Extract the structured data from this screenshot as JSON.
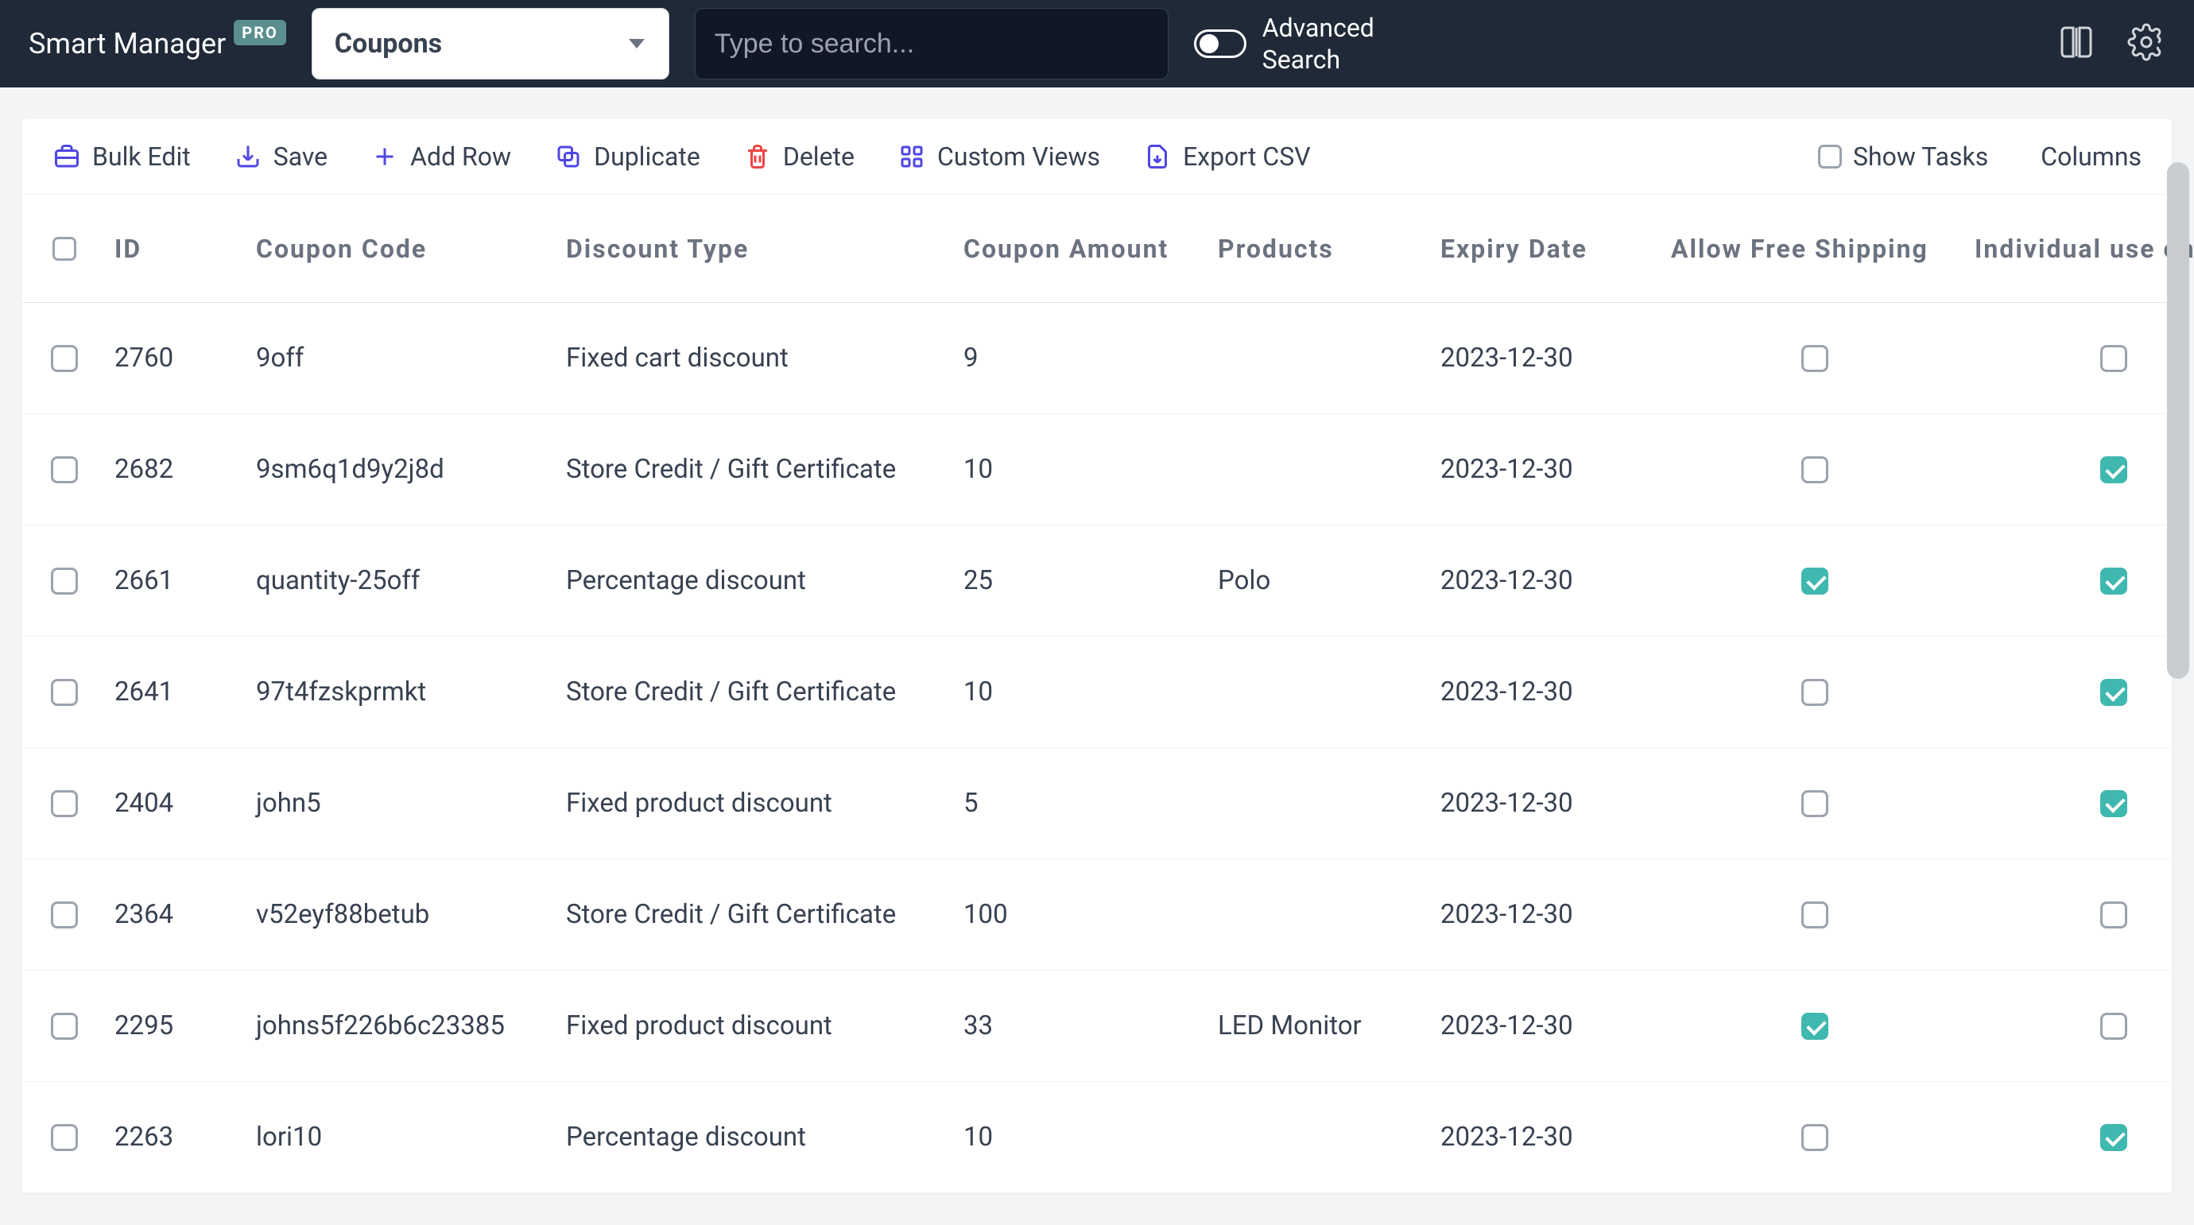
{
  "brand": {
    "title": "Smart Manager",
    "badge": "PRO"
  },
  "selector": {
    "value": "Coupons"
  },
  "search": {
    "placeholder": "Type to search..."
  },
  "advanced": {
    "line1": "Advanced",
    "line2": "Search"
  },
  "toolbar": {
    "bulk_edit": "Bulk Edit",
    "save": "Save",
    "add_row": "Add Row",
    "duplicate": "Duplicate",
    "delete": "Delete",
    "custom_views": "Custom Views",
    "export_csv": "Export CSV",
    "show_tasks": "Show Tasks",
    "columns": "Columns"
  },
  "columns": [
    "ID",
    "Coupon Code",
    "Discount Type",
    "Coupon Amount",
    "Products",
    "Expiry Date",
    "Allow Free Shipping",
    "Individual use only"
  ],
  "rows": [
    {
      "id": "2760",
      "code": "9off",
      "type": "Fixed cart discount",
      "amount": "9",
      "products": "",
      "expiry": "2023-12-30",
      "free_ship": false,
      "individual": false
    },
    {
      "id": "2682",
      "code": "9sm6q1d9y2j8d",
      "type": "Store Credit / Gift Certificate",
      "amount": "10",
      "products": "",
      "expiry": "2023-12-30",
      "free_ship": false,
      "individual": true
    },
    {
      "id": "2661",
      "code": "quantity-25off",
      "type": "Percentage discount",
      "amount": "25",
      "products": "Polo",
      "expiry": "2023-12-30",
      "free_ship": true,
      "individual": true
    },
    {
      "id": "2641",
      "code": "97t4fzskprmkt",
      "type": "Store Credit / Gift Certificate",
      "amount": "10",
      "products": "",
      "expiry": "2023-12-30",
      "free_ship": false,
      "individual": true
    },
    {
      "id": "2404",
      "code": "john5",
      "type": "Fixed product discount",
      "amount": "5",
      "products": "",
      "expiry": "2023-12-30",
      "free_ship": false,
      "individual": true
    },
    {
      "id": "2364",
      "code": "v52eyf88betub",
      "type": "Store Credit / Gift Certificate",
      "amount": "100",
      "products": "",
      "expiry": "2023-12-30",
      "free_ship": false,
      "individual": false
    },
    {
      "id": "2295",
      "code": "johns5f226b6c23385",
      "type": "Fixed product discount",
      "amount": "33",
      "products": "LED Monitor",
      "expiry": "2023-12-30",
      "free_ship": true,
      "individual": false
    },
    {
      "id": "2263",
      "code": "lori10",
      "type": "Percentage discount",
      "amount": "10",
      "products": "",
      "expiry": "2023-12-30",
      "free_ship": false,
      "individual": true
    }
  ]
}
